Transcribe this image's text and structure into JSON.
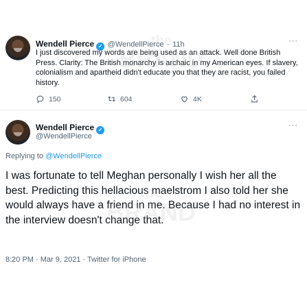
{
  "tweet1": {
    "author_name": "Wendell Pierce",
    "handle": "@WendellPierce",
    "separator": "·",
    "time": "11h",
    "more": "···",
    "text": "I just discovered my words are being used as an attack. Well done British Press. Clarity: The British monarchy is archaic in my American eyes. If slavery, colonialism and apartheid didn't educate you that they are racist, you failed history.",
    "actions": {
      "replies": "150",
      "retweets": "604",
      "likes": "4K"
    }
  },
  "tweet2": {
    "author_name": "Wendell Pierce",
    "handle": "@WendellPierce",
    "more": "···",
    "replying_prefix": "Replying to",
    "replying_to": "@WendellPierce",
    "text": "I was fortunate to tell Meghan personally I wish her all the best. Predicting this hellacious maelstrom I also told her she would always have a friend in me. Because I had no interest in the interview doesn't change that.",
    "meta": "8:20 PM · Mar 9, 2021 · Twitter for iPhone"
  },
  "watermark": {
    "line1": "the",
    "line2": "BRAND"
  },
  "colors": {
    "accent": "#1d9bf0",
    "text": "#0f1419",
    "muted": "#536471"
  }
}
